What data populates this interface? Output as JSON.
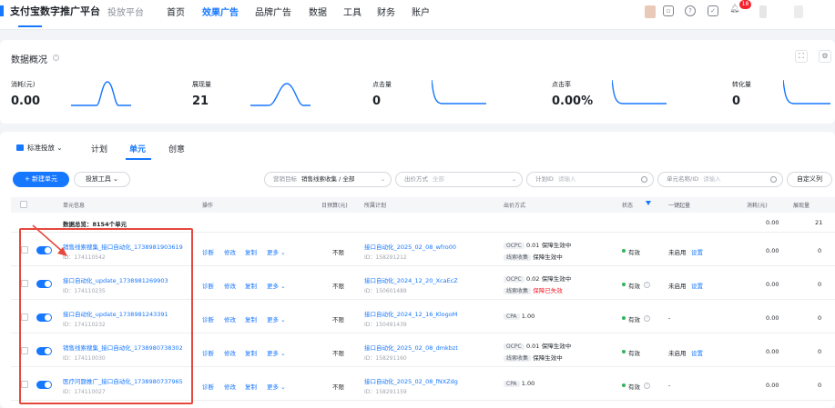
{
  "nav": {
    "brand": "支付宝数字推广平台",
    "platform": "投放平台",
    "items": [
      {
        "label": "首页",
        "active": false
      },
      {
        "label": "效果广告",
        "active": true
      },
      {
        "label": "品牌广告",
        "active": false
      },
      {
        "label": "数据",
        "active": false
      },
      {
        "label": "工具",
        "active": false
      },
      {
        "label": "财务",
        "active": false
      },
      {
        "label": "账户",
        "active": false
      }
    ],
    "bell_badge": "18"
  },
  "overview": {
    "title": "数据概况",
    "metrics": [
      {
        "label": "消耗(元)",
        "value": "0.00"
      },
      {
        "label": "展现量",
        "value": "21"
      },
      {
        "label": "点击量",
        "value": "0"
      },
      {
        "label": "点击率",
        "value": "0.00%"
      },
      {
        "label": "转化量",
        "value": "0"
      }
    ]
  },
  "main": {
    "standard_label": "标准投放",
    "tabs": [
      {
        "label": "计划",
        "active": false
      },
      {
        "label": "单元",
        "active": true
      },
      {
        "label": "创意",
        "active": false
      }
    ],
    "new_button": "+ 新建单元",
    "tools_button": "投放工具",
    "filters": {
      "goal_label": "营销目标",
      "goal_value": "销售线索收集 / 全部",
      "bid_label": "出价方式",
      "bid_value": "全部",
      "plan_id_label": "计划ID",
      "plan_id_placeholder": "请输入",
      "unit_label": "单元名称/ID",
      "unit_placeholder": "请输入"
    },
    "custom_columns": "自定义列",
    "headers": {
      "unit_info": "单元信息",
      "actions": "操作",
      "daily_budget": "日预算(元)",
      "plan": "所属计划",
      "bid": "出价方式",
      "status": "状态",
      "one_click": "一键起量",
      "cost": "消耗(元)",
      "impressions": "展现量"
    },
    "summary": {
      "label": "数据总览：8154个单元",
      "cost": "0.00",
      "impressions": "21"
    },
    "action_labels": {
      "diagnose": "诊断",
      "edit": "修改",
      "copy": "复制",
      "more": "更多"
    },
    "rows": [
      {
        "name": "销售线索搜集_接口自动化_1738981903619",
        "id": "ID：174110542",
        "budget": "不限",
        "plan_name": "接口自动化_2025_02_08_wfro00",
        "plan_id": "ID：158291212",
        "bid_tag": "OCPC",
        "bid_value": "0.01",
        "bid_status": "保障生效中",
        "bid_tag2": "线索收集",
        "bid_status2": "保障生效中",
        "bid_status2_red": false,
        "status": "有效",
        "one_click": "未启用",
        "one_click_link": "设置",
        "cost": "0.00",
        "impressions": "0"
      },
      {
        "name": "接口自动化_update_1738981269903",
        "id": "ID：174110235",
        "budget": "不限",
        "plan_name": "接口自动化_2024_12_20_XcaEcZ",
        "plan_id": "ID：150601489",
        "bid_tag": "OCPC",
        "bid_value": "0.02",
        "bid_status": "保障生效中",
        "bid_tag2": "线索收集",
        "bid_status2": "保障已失效",
        "bid_status2_red": true,
        "status": "有效",
        "one_click": "未启用",
        "one_click_link": "设置",
        "cost": "0.00",
        "impressions": "0"
      },
      {
        "name": "接口自动化_update_1738981243391",
        "id": "ID：174110232",
        "budget": "不限",
        "plan_name": "接口自动化_2024_12_16_KlogoM",
        "plan_id": "ID：150491439",
        "bid_tag": "CPA",
        "bid_value": "1.00",
        "bid_status": "",
        "bid_tag2": "",
        "bid_status2": "",
        "bid_status2_red": false,
        "status": "有效",
        "one_click": "-",
        "one_click_link": "",
        "cost": "0.00",
        "impressions": "0"
      },
      {
        "name": "销售线索搜集_接口自动化_1738980738302",
        "id": "ID：174110030",
        "budget": "不限",
        "plan_name": "接口自动化_2025_02_08_dmkbzt",
        "plan_id": "ID：158291160",
        "bid_tag": "OCPC",
        "bid_value": "0.01",
        "bid_status": "保障生效中",
        "bid_tag2": "线索收集",
        "bid_status2": "保障生效中",
        "bid_status2_red": false,
        "status": "有效",
        "one_click": "未启用",
        "one_click_link": "设置",
        "cost": "0.00",
        "impressions": "0"
      },
      {
        "name": "医疗问题推广_接口自动化_1738980737965",
        "id": "ID：174110027",
        "budget": "不限",
        "plan_name": "接口自动化_2025_02_08_fNXZdg",
        "plan_id": "ID：158291159",
        "bid_tag": "CPA",
        "bid_value": "1.00",
        "bid_status": "",
        "bid_tag2": "",
        "bid_status2": "",
        "bid_status2_red": false,
        "status": "有效",
        "one_click": "-",
        "one_click_link": "",
        "cost": "0.00",
        "impressions": "0"
      }
    ]
  },
  "colors": {
    "primary": "#1677ff",
    "highlight": "#e5483c",
    "success": "#2fb45a",
    "danger": "#f5222d"
  }
}
